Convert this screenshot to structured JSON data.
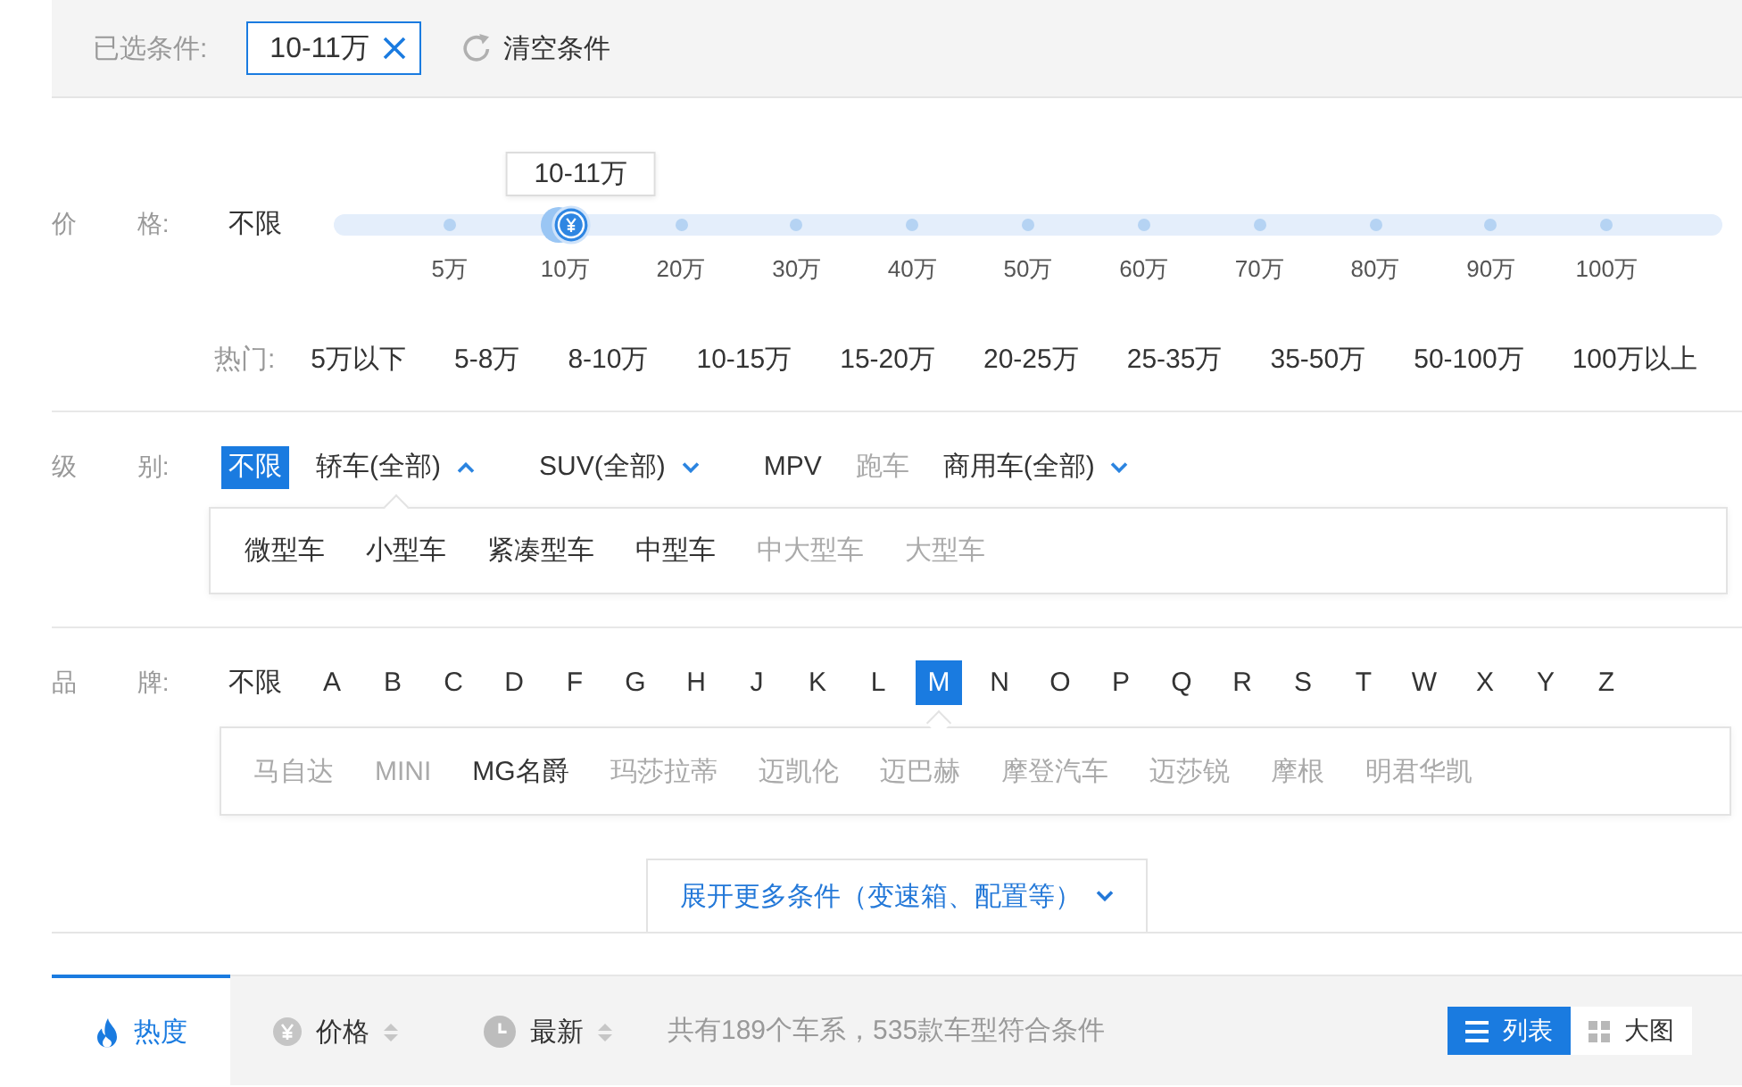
{
  "selected_bar": {
    "label": "已选条件:",
    "tags": [
      {
        "text": "10-11万"
      }
    ],
    "clear_button": "清空条件"
  },
  "price": {
    "label": "价 格:",
    "unlimited": {
      "text": "不限",
      "selected": false
    },
    "slider": {
      "tooltip": "10-11万",
      "level": 0.167,
      "ticks": [
        "5万",
        "10万",
        "20万",
        "30万",
        "40万",
        "50万",
        "60万",
        "70万",
        "80万",
        "90万",
        "100万"
      ]
    },
    "hot": {
      "label": "热门:",
      "items": [
        "5万以下",
        "5-8万",
        "8-10万",
        "10-15万",
        "15-20万",
        "20-25万",
        "25-35万",
        "35-50万",
        "50-100万",
        "100万以上"
      ]
    }
  },
  "vehicle_class": {
    "label": "级 别:",
    "options": [
      {
        "text": "不限",
        "kind": "plain",
        "selected": true,
        "disabled": false
      },
      {
        "text": "轿车(全部)",
        "kind": "dropdown",
        "selected": false,
        "disabled": false,
        "expanded": true
      },
      {
        "text": "SUV(全部)",
        "kind": "dropdown",
        "selected": false,
        "disabled": false,
        "expanded": false
      },
      {
        "text": "MPV",
        "kind": "plain",
        "selected": false,
        "disabled": false
      },
      {
        "text": "跑车",
        "kind": "plain",
        "selected": false,
        "disabled": true
      },
      {
        "text": "商用车(全部)",
        "kind": "dropdown",
        "selected": false,
        "disabled": false,
        "expanded": false
      }
    ],
    "submenu": [
      {
        "text": "微型车",
        "disabled": false
      },
      {
        "text": "小型车",
        "disabled": false
      },
      {
        "text": "紧凑型车",
        "disabled": false
      },
      {
        "text": "中型车",
        "disabled": false
      },
      {
        "text": "中大型车",
        "disabled": true
      },
      {
        "text": "大型车",
        "disabled": true
      }
    ]
  },
  "brand": {
    "label": "品 牌:",
    "letters": [
      {
        "text": "不限",
        "selected": false
      },
      {
        "text": "A",
        "selected": false
      },
      {
        "text": "B",
        "selected": false
      },
      {
        "text": "C",
        "selected": false
      },
      {
        "text": "D",
        "selected": false
      },
      {
        "text": "F",
        "selected": false
      },
      {
        "text": "G",
        "selected": false
      },
      {
        "text": "H",
        "selected": false
      },
      {
        "text": "J",
        "selected": false
      },
      {
        "text": "K",
        "selected": false
      },
      {
        "text": "L",
        "selected": false
      },
      {
        "text": "M",
        "selected": true
      },
      {
        "text": "N",
        "selected": false
      },
      {
        "text": "O",
        "selected": false
      },
      {
        "text": "P",
        "selected": false
      },
      {
        "text": "Q",
        "selected": false
      },
      {
        "text": "R",
        "selected": false
      },
      {
        "text": "S",
        "selected": false
      },
      {
        "text": "T",
        "selected": false
      },
      {
        "text": "W",
        "selected": false
      },
      {
        "text": "X",
        "selected": false
      },
      {
        "text": "Y",
        "selected": false
      },
      {
        "text": "Z",
        "selected": false
      }
    ],
    "brands": [
      {
        "text": "马自达",
        "disabled": true
      },
      {
        "text": "MINI",
        "disabled": true
      },
      {
        "text": "MG名爵",
        "disabled": false
      },
      {
        "text": "玛莎拉蒂",
        "disabled": true
      },
      {
        "text": "迈凯伦",
        "disabled": true
      },
      {
        "text": "迈巴赫",
        "disabled": true
      },
      {
        "text": "摩登汽车",
        "disabled": true
      },
      {
        "text": "迈莎锐",
        "disabled": true
      },
      {
        "text": "摩根",
        "disabled": true
      },
      {
        "text": "明君华凯",
        "disabled": true
      }
    ]
  },
  "more_button": {
    "text": "展开更多条件（变速箱、配置等）",
    "expanded": false
  },
  "sort_bar": {
    "tabs": [
      {
        "text": "热度",
        "kind": "hot",
        "selected": true,
        "sortable": false
      },
      {
        "text": "价格",
        "kind": "price",
        "selected": false,
        "sortable": true
      },
      {
        "text": "最新",
        "kind": "newest",
        "selected": false,
        "sortable": true
      }
    ],
    "summary": "共有189个车系，535款车型符合条件",
    "views": [
      {
        "text": "列表",
        "kind": "list",
        "selected": true
      },
      {
        "text": "大图",
        "kind": "grid",
        "selected": false
      }
    ]
  }
}
